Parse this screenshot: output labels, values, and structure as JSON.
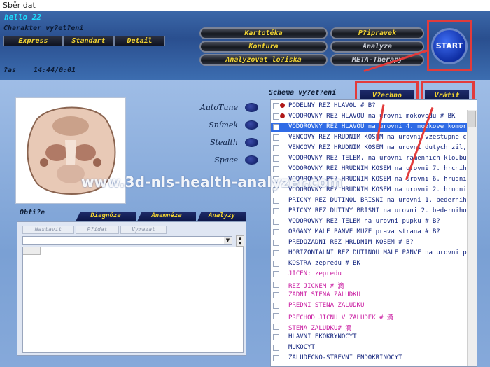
{
  "window": {
    "title": "Sběr dat"
  },
  "header": {
    "greeting": "hello  22",
    "character_label": "Charakter vy?et?ení",
    "modes": [
      "Express",
      "Standart",
      "Detail"
    ],
    "time_label": "?as",
    "time_value": "14:44/0:01"
  },
  "menu": {
    "left": [
      "Kartotéka",
      "Kontura",
      "Analyzovat lo?iska"
    ],
    "right": [
      "P?ipravek",
      "Analyza",
      "META-Therapy"
    ]
  },
  "start_label": "START",
  "options": [
    "AutoTune",
    "Snímek",
    "Stealth",
    "Space"
  ],
  "schema": {
    "label": "Schema vy?et?ení",
    "all_button": "V?echno",
    "return_button": "Vrátit",
    "items": [
      {
        "text": "PODELNY REZ HLAVOU # B?",
        "dot": true
      },
      {
        "text": "VODOROVNY REZ HLAVOU na urovni mokovodu # BK",
        "dot": true
      },
      {
        "text": "VODOROVNY REZ HLAVOU na urovni 4. mozkove komory # BK",
        "selected": true
      },
      {
        "text": "VENCOVY REZ HRUDNIM KOSEM  na urovni vzestupne casti"
      },
      {
        "text": "VENCOVY REZ HRUDNIM KOSEM  na urovni dutych zil, pohl"
      },
      {
        "text": "VODOROVNY REZ TELEM, na urovni ramennich kloubu # B?"
      },
      {
        "text": "VODOROVNY REZ HRUDNIM KOSEM  na urovni 7. hrcniho obra"
      },
      {
        "text": "VODOROVNY REZ HRUDNIM KOSEM  na urovni 6. hrudniho obr"
      },
      {
        "text": "VODOROVNY REZ HRUDNIM KOSEM  na urovni 2. hrudniho obr"
      },
      {
        "text": "PRICNY REZ DUTINOU BRISNI na urovni 1. bederniho obra"
      },
      {
        "text": "PRICNY REZ DUTINY BRISNI na urovni 2. bederniho obra"
      },
      {
        "text": "VODOROVNY REZ TELEM  na urovni pupku # B?"
      },
      {
        "text": "ORGANY MALE PANVE MUZE prava strana  # B?"
      },
      {
        "text": "PREDOZADNI REZ HRUDNIM KOSEM # B?"
      },
      {
        "text": "HORIZONTALNI REZ DUTINOU MALE PANVE na urovni prostat"
      },
      {
        "text": "KOSTRA zepredu # BK"
      },
      {
        "text": "JICEN:  zepredu",
        "pink": true
      },
      {
        "text": "REZ JICNEM # 滴",
        "pink": true
      },
      {
        "text": "ZADNI STENA ZALUDKU",
        "pink": true
      },
      {
        "text": "PREDNI STENA ZALUDKU",
        "pink": true
      },
      {
        "text": "PRECHOD JICNU V ZALUDEK # 滴",
        "pink": true
      },
      {
        "text": "STENA ZALUDKU# 滴",
        "pink": true
      },
      {
        "text": "HLAVNI  EKOKRYNOCYT"
      },
      {
        "text": "MUKOCYT"
      },
      {
        "text": "ZALUDECNO-STREVNI ENDOKRINOCYT"
      }
    ]
  },
  "complaints": {
    "label": "Obtí?e",
    "tabs": [
      "Diagnóza",
      "Anamnéza",
      "Analyzy"
    ],
    "buttons": [
      "Nastavit",
      "P?idat",
      "Vymazat"
    ]
  },
  "watermark": "www.3d-nls-health-analyzer.com",
  "colors": {
    "accent_red": "#e23b3b",
    "selection": "#2f6be6",
    "menu_text": "#f0d232"
  }
}
